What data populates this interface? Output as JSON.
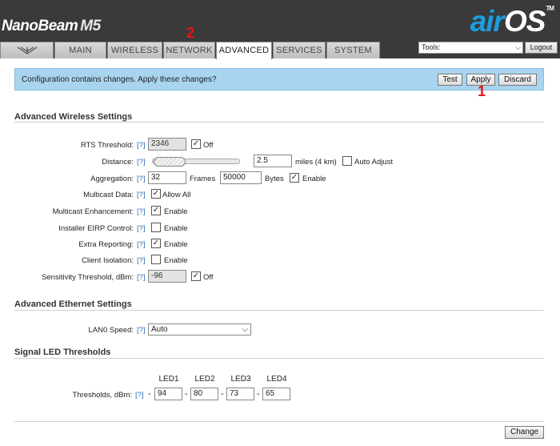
{
  "header": {
    "product_name": "NanoBeam",
    "product_model": "M5",
    "logo_air": "air",
    "logo_os": "OS",
    "logo_tm": "TM",
    "tools_selected": "Tools:",
    "logout_label": "Logout",
    "tabs": [
      {
        "label": "ubnt-logo-icon",
        "active": false
      },
      {
        "label": "MAIN",
        "active": false
      },
      {
        "label": "WIRELESS",
        "active": false
      },
      {
        "label": "NETWORK",
        "active": false
      },
      {
        "label": "ADVANCED",
        "active": true
      },
      {
        "label": "SERVICES",
        "active": false
      },
      {
        "label": "SYSTEM",
        "active": false
      }
    ]
  },
  "notice": {
    "text": "Configuration contains changes. Apply these changes?",
    "test_label": "Test",
    "apply_label": "Apply",
    "discard_label": "Discard"
  },
  "markers": {
    "one": "1",
    "two": "2"
  },
  "help_label": "[?]",
  "wireless": {
    "title": "Advanced Wireless Settings",
    "rts_label": "RTS Threshold:",
    "rts_value": "2346",
    "rts_off_checked": true,
    "rts_off_label": "Off",
    "distance_label": "Distance:",
    "distance_value": "2.5",
    "distance_unit": "miles (4 km)",
    "auto_adjust_checked": false,
    "auto_adjust_label": "Auto Adjust",
    "aggregation_label": "Aggregation:",
    "aggregation_frames_value": "32",
    "aggregation_frames_label": "Frames",
    "aggregation_bytes_value": "50000",
    "aggregation_bytes_label": "Bytes",
    "aggregation_enable_checked": true,
    "aggregation_enable_label": "Enable",
    "multicast_data_label": "Multicast Data:",
    "multicast_data_checked": true,
    "multicast_data_option": "Allow All",
    "multicast_enh_label": "Multicast Enhancement:",
    "multicast_enh_checked": true,
    "installer_eirp_label": "Installer EIRP Control:",
    "installer_eirp_checked": false,
    "extra_reporting_label": "Extra Reporting:",
    "extra_reporting_checked": true,
    "client_isolation_label": "Client Isolation:",
    "client_isolation_checked": false,
    "sensitivity_label": "Sensitivity Threshold, dBm:",
    "sensitivity_value": "-96",
    "sensitivity_off_checked": true,
    "sensitivity_off_label": "Off",
    "enable_label": "Enable"
  },
  "ethernet": {
    "title": "Advanced Ethernet Settings",
    "lan0_label": "LAN0 Speed:",
    "lan0_value": "Auto"
  },
  "led": {
    "title": "Signal LED Thresholds",
    "headers": [
      "LED1",
      "LED2",
      "LED3",
      "LED4"
    ],
    "row_label": "Thresholds, dBm:",
    "values": [
      "94",
      "80",
      "73",
      "65"
    ],
    "dash": "-"
  },
  "footer": {
    "change_label": "Change"
  }
}
